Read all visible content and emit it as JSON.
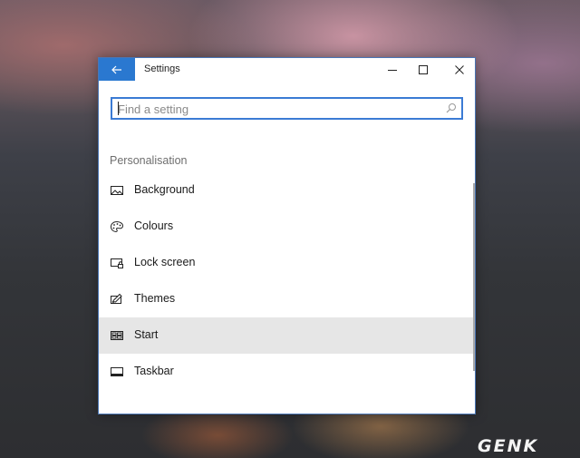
{
  "window": {
    "title": "Settings",
    "accent": "#2a78d0"
  },
  "search": {
    "placeholder": "Find a setting"
  },
  "section": {
    "title": "Personalisation"
  },
  "items": [
    {
      "label": "Background",
      "icon": "picture-icon"
    },
    {
      "label": "Colours",
      "icon": "palette-icon"
    },
    {
      "label": "Lock screen",
      "icon": "lock-screen-icon"
    },
    {
      "label": "Themes",
      "icon": "paint-brush-icon"
    },
    {
      "label": "Start",
      "icon": "start-tiles-icon",
      "selected": true
    },
    {
      "label": "Taskbar",
      "icon": "taskbar-icon"
    }
  ],
  "watermark": {
    "text": "GENK"
  }
}
